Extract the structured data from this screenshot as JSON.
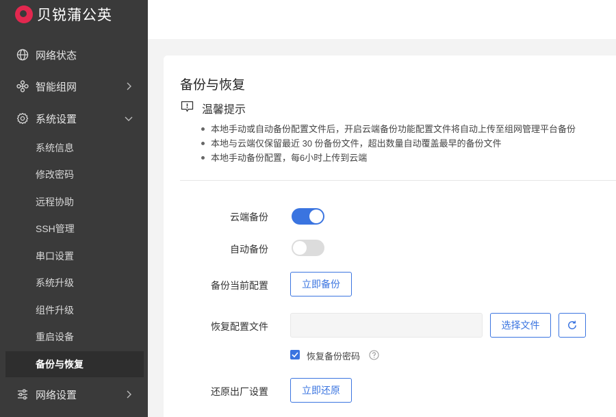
{
  "brand": {
    "name": "贝锐蒲公英",
    "accent": "#e2284f"
  },
  "sidebar": {
    "menu": [
      {
        "label": "网络状态",
        "icon": "globe-icon"
      },
      {
        "label": "智能组网",
        "icon": "network-nodes-icon"
      },
      {
        "label": "系统设置",
        "icon": "gear-icon"
      }
    ],
    "submenu": [
      {
        "label": "系统信息"
      },
      {
        "label": "修改密码"
      },
      {
        "label": "远程协助"
      },
      {
        "label": "SSH管理"
      },
      {
        "label": "串口设置"
      },
      {
        "label": "系统升级"
      },
      {
        "label": "组件升级"
      },
      {
        "label": "重启设备"
      },
      {
        "label": "备份与恢复",
        "active": true
      }
    ],
    "bottom": {
      "label": "网络设置",
      "icon": "sliders-icon"
    }
  },
  "page": {
    "title": "备份与恢复",
    "tip_title": "温馨提示",
    "tips": [
      "本地手动或自动备份配置文件后，开启云端备份功能配置文件将自动上传至组网管理平台备份",
      "本地与云端仅保留最近 30 份备份文件，超出数量自动覆盖最早的备份文件",
      "本地手动备份配置，每6小时上传到云端"
    ]
  },
  "form": {
    "cloud_backup": {
      "label": "云端备份",
      "enabled": true
    },
    "auto_backup": {
      "label": "自动备份",
      "enabled": false
    },
    "backup_now": {
      "label": "备份当前配置",
      "button": "立即备份"
    },
    "restore_file": {
      "label": "恢复配置文件",
      "value": "",
      "button": "选择文件"
    },
    "restore_password": {
      "label": "恢复备份密码",
      "checked": true
    },
    "factory_reset": {
      "label": "还原出厂设置",
      "button": "立即还原"
    }
  },
  "colors": {
    "primary": "#3a74e0",
    "sidebar_bg": "#3a3a3a"
  }
}
